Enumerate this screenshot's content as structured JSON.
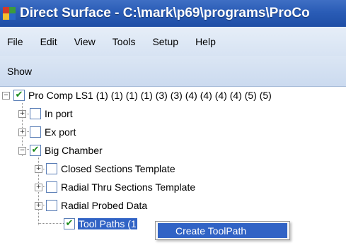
{
  "window": {
    "title": "Direct Surface - C:\\mark\\p69\\programs\\ProCo"
  },
  "menu": {
    "items": [
      "File",
      "Edit",
      "View",
      "Tools",
      "Setup",
      "Help"
    ]
  },
  "toolbar": {
    "show_label": "Show"
  },
  "tree": {
    "root": {
      "label": "Pro Comp LS1 (1) (1) (1) (1) (3) (3) (4) (4) (4) (4) (5) (5)",
      "checked": true,
      "expanded": true
    },
    "in_port": {
      "label": "In port",
      "checked": false
    },
    "ex_port": {
      "label": "Ex port",
      "checked": false
    },
    "big_chamber": {
      "label": "Big Chamber",
      "checked": true,
      "expanded": true
    },
    "closed_sections": {
      "label": "Closed Sections Template",
      "checked": false
    },
    "radial_thru": {
      "label": "Radial Thru Sections Template",
      "checked": false
    },
    "radial_probed": {
      "label": "Radial Probed Data",
      "checked": false
    },
    "tool_paths": {
      "label": "Tool Paths (1",
      "checked": true,
      "selected": true
    }
  },
  "context_menu": {
    "items": [
      "Create ToolPath"
    ]
  },
  "icons": {
    "expand": "plus-box-icon",
    "collapse": "minus-box-icon",
    "check": "checkmark-icon"
  },
  "colors": {
    "titlebar": "#2a5cb6",
    "selection": "#3163c5",
    "check": "#1a8a1a"
  }
}
